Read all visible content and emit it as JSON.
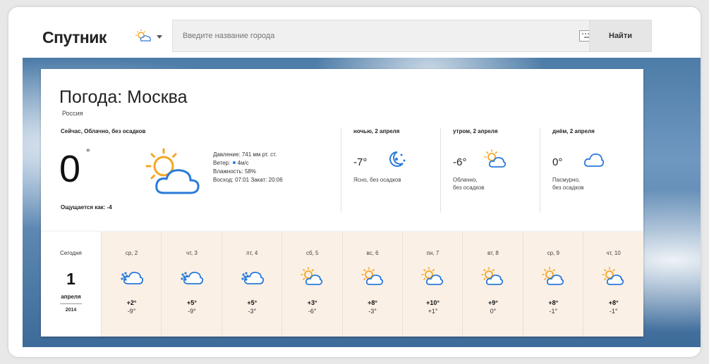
{
  "header": {
    "logo": "Спутник",
    "search_placeholder": "Введите название города",
    "find_button": "Найти"
  },
  "current": {
    "title": "Погода: Москва",
    "country": "Россия",
    "now_label": "Сейчас, Облачно, без осадков",
    "temp": "0",
    "degree_sign": "°",
    "feels_like": "Ощущается как: -4",
    "pressure": "Давление: 741 мм рт. ст.",
    "wind": "Ветер:",
    "wind_value": "4м/с",
    "humidity": "Влажность: 58%",
    "sun": "Восход: 07:01 Закат: 20:06",
    "icon": "partly-cloudy-icon"
  },
  "dayparts": [
    {
      "label": "ночью, 2 апреля",
      "temp": "-7°",
      "desc_line1": "Ясно, без осадков",
      "desc_line2": "",
      "icon": "clear-night-icon"
    },
    {
      "label": "утром, 2 апреля",
      "temp": "-6°",
      "desc_line1": "Облачно,",
      "desc_line2": "без осадков",
      "icon": "partly-cloudy-icon"
    },
    {
      "label": "днём, 2 апреля",
      "temp": "0°",
      "desc_line1": "Пасмурно,",
      "desc_line2": "без осадков",
      "icon": "cloud-icon"
    }
  ],
  "today": {
    "label": "Сегодня",
    "day": "1",
    "month": "апреля",
    "year": "2014"
  },
  "forecast": [
    {
      "name": "ср, 2",
      "hi": "+2°",
      "lo": "-9°",
      "icon": "snow-cloud-icon"
    },
    {
      "name": "чт, 3",
      "hi": "+5°",
      "lo": "-9°",
      "icon": "snow-cloud-icon"
    },
    {
      "name": "пт, 4",
      "hi": "+5°",
      "lo": "-3°",
      "icon": "snow-cloud-icon"
    },
    {
      "name": "сб, 5",
      "hi": "+3°",
      "lo": "-6°",
      "icon": "partly-cloudy-icon"
    },
    {
      "name": "вс, 6",
      "hi": "+8°",
      "lo": "-3°",
      "icon": "partly-cloudy-icon"
    },
    {
      "name": "пн, 7",
      "hi": "+10°",
      "lo": "+1°",
      "icon": "partly-cloudy-icon"
    },
    {
      "name": "вт, 8",
      "hi": "+9°",
      "lo": "0°",
      "icon": "partly-cloudy-icon"
    },
    {
      "name": "ср, 9",
      "hi": "+8°",
      "lo": "-1°",
      "icon": "partly-cloudy-icon"
    },
    {
      "name": "чт, 10",
      "hi": "+8°",
      "lo": "-1°",
      "icon": "partly-cloudy-icon"
    }
  ],
  "colors": {
    "sun": "#f5a623",
    "cloud": "#2a7ad9",
    "forecast_bg": "#faf0e6"
  }
}
